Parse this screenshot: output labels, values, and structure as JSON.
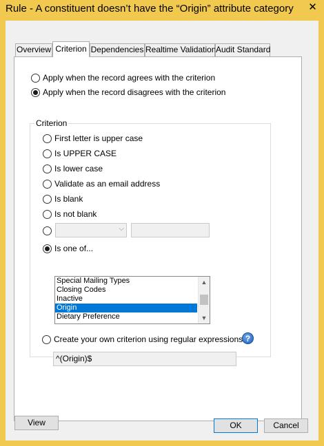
{
  "window": {
    "title": "Rule - A constituent doesn’t have the “Origin” attribute category",
    "close_icon": "close-icon"
  },
  "tabs": [
    {
      "label": "Overview"
    },
    {
      "label": "Criterion",
      "active": true
    },
    {
      "label": "Dependencies"
    },
    {
      "label": "Realtime Validation"
    },
    {
      "label": "Audit Standard"
    }
  ],
  "apply": {
    "agrees": "Apply when the record agrees with the criterion",
    "disagrees": "Apply when the record disagrees with the criterion",
    "selected": "disagrees"
  },
  "criterion": {
    "group_label": "Criterion",
    "options": [
      "First letter is upper case",
      "Is UPPER CASE",
      "Is lower case",
      "Validate as an email address",
      "Is blank",
      "Is not blank"
    ],
    "custom_combo_value": "",
    "custom_text_value": "",
    "is_one_of_label": "Is one of...",
    "selected": "is_one_of",
    "list_items": [
      "Special Mailing Types",
      "Closing Codes",
      "Inactive",
      "Origin",
      "Dietary Preference"
    ],
    "list_selected": "Origin",
    "regex_label": "Create your own criterion using regular expressions",
    "regex_value": "^(Origin)$",
    "help_icon": "help-icon"
  },
  "buttons": {
    "view": "View",
    "ok": "OK",
    "cancel": "Cancel"
  },
  "colors": {
    "title_bar": "#f0c94e",
    "selection": "#0078d7"
  }
}
